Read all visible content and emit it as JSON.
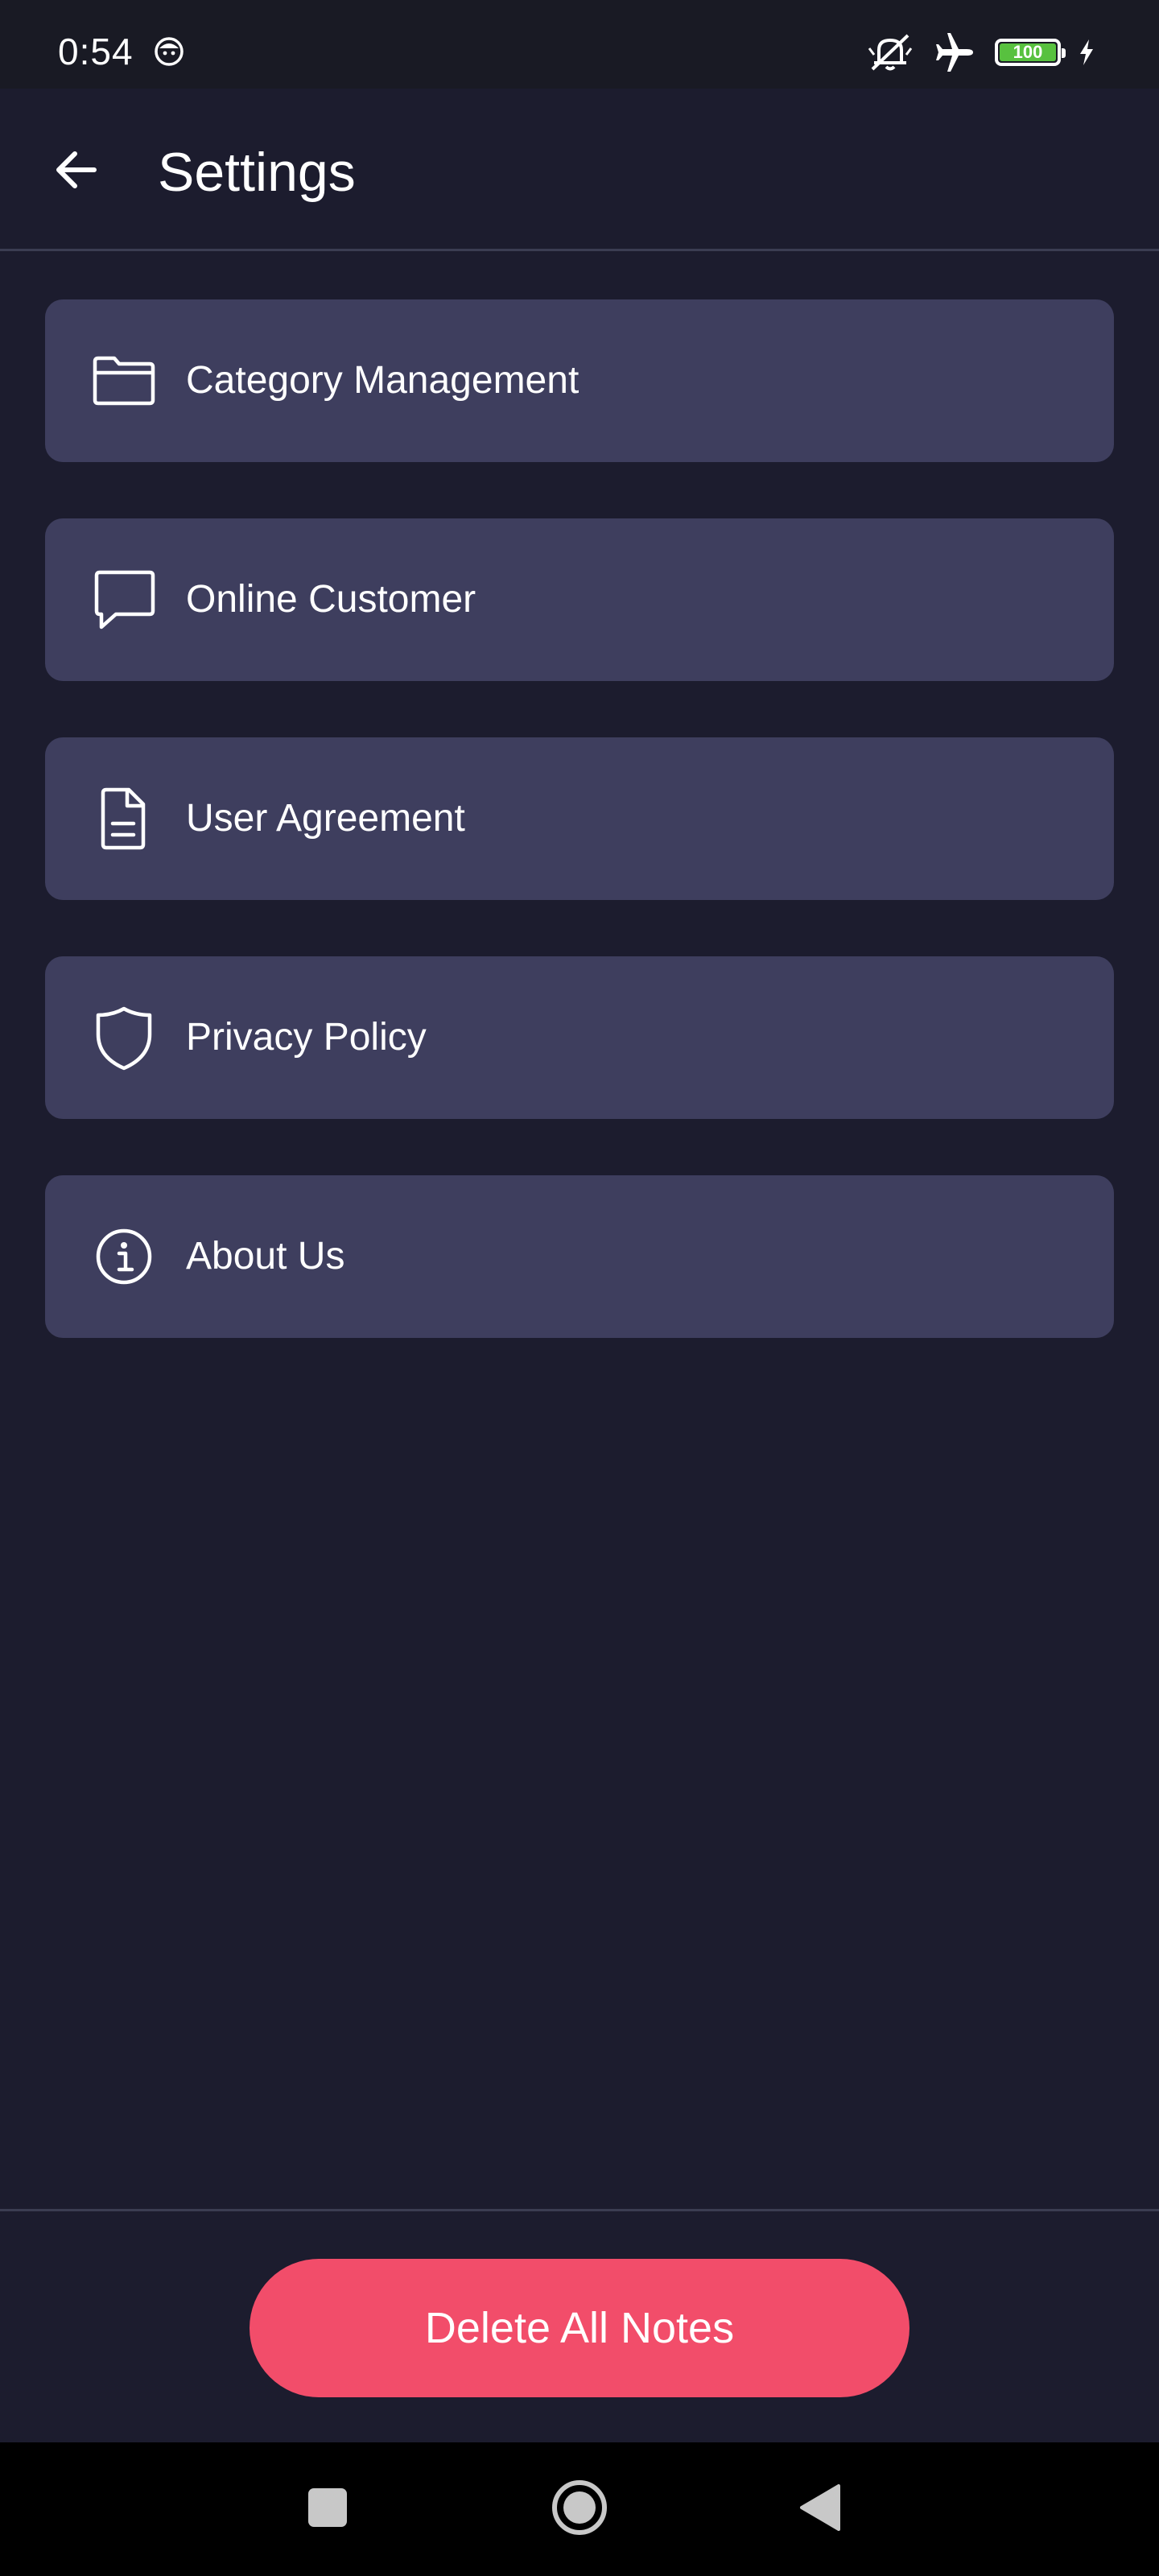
{
  "status_bar": {
    "time": "0:54",
    "battery_level": "100",
    "icons": [
      "notification-face-icon",
      "silent-icon",
      "airplane-mode-icon",
      "battery-icon",
      "charging-icon"
    ]
  },
  "header": {
    "title": "Settings",
    "back_icon": "arrow-left-icon"
  },
  "settings": {
    "items": [
      {
        "label": "Category Management",
        "icon": "folder-icon"
      },
      {
        "label": "Online Customer",
        "icon": "chat-bubble-icon"
      },
      {
        "label": "User Agreement",
        "icon": "document-icon"
      },
      {
        "label": "Privacy Policy",
        "icon": "shield-icon"
      },
      {
        "label": "About Us",
        "icon": "info-icon"
      }
    ]
  },
  "footer": {
    "delete_label": "Delete All Notes"
  },
  "nav_bar": {
    "icons": [
      "recent-apps-icon",
      "home-icon",
      "back-triangle-icon"
    ]
  },
  "colors": {
    "background": "#1c1c2e",
    "card": "#3e3e5e",
    "danger": "#f24d6a",
    "battery": "#58c13f"
  }
}
